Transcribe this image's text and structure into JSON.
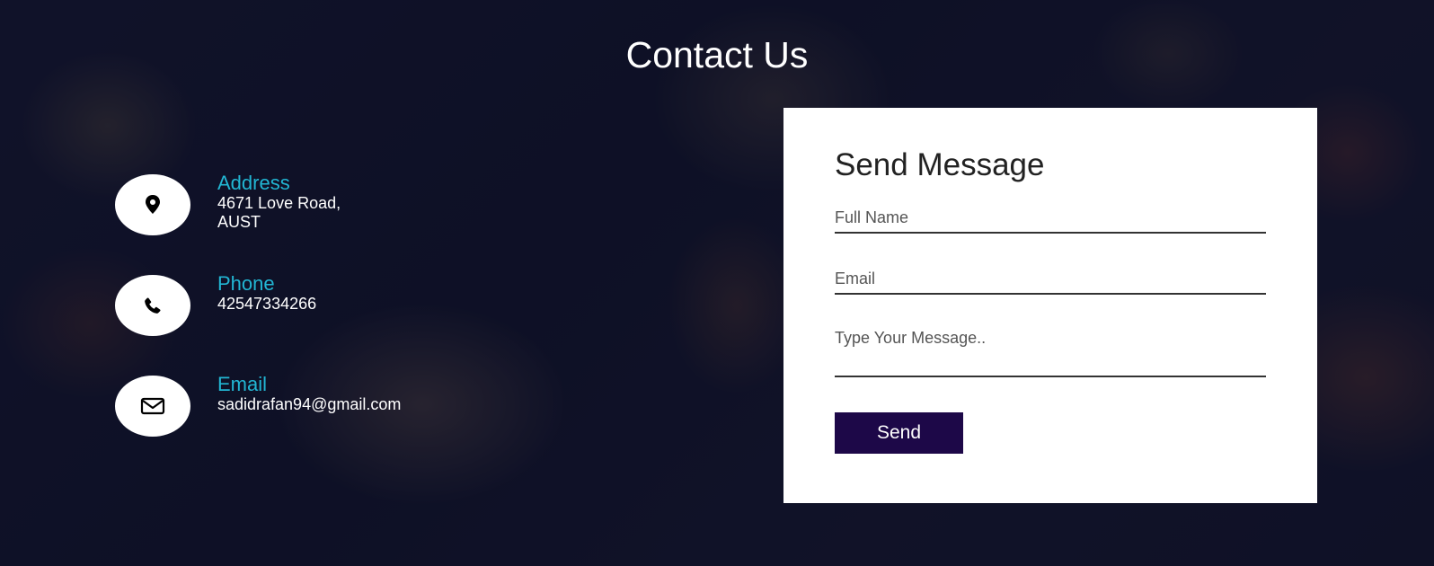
{
  "page": {
    "title": "Contact Us"
  },
  "contact_info": {
    "address": {
      "label": "Address",
      "value": "4671 Love Road,\nAUST",
      "icon": "map-pin-icon"
    },
    "phone": {
      "label": "Phone",
      "value": "42547334266",
      "icon": "phone-icon"
    },
    "email": {
      "label": "Email",
      "value": "sadidrafan94@gmail.com",
      "icon": "envelope-icon"
    }
  },
  "form": {
    "title": "Send Message",
    "full_name_placeholder": "Full Name",
    "email_placeholder": "Email",
    "message_placeholder": "Type Your Message..",
    "send_label": "Send"
  },
  "colors": {
    "accent": "#22b6d3",
    "button": "#1d0848",
    "overlay": "#0a0c23"
  }
}
